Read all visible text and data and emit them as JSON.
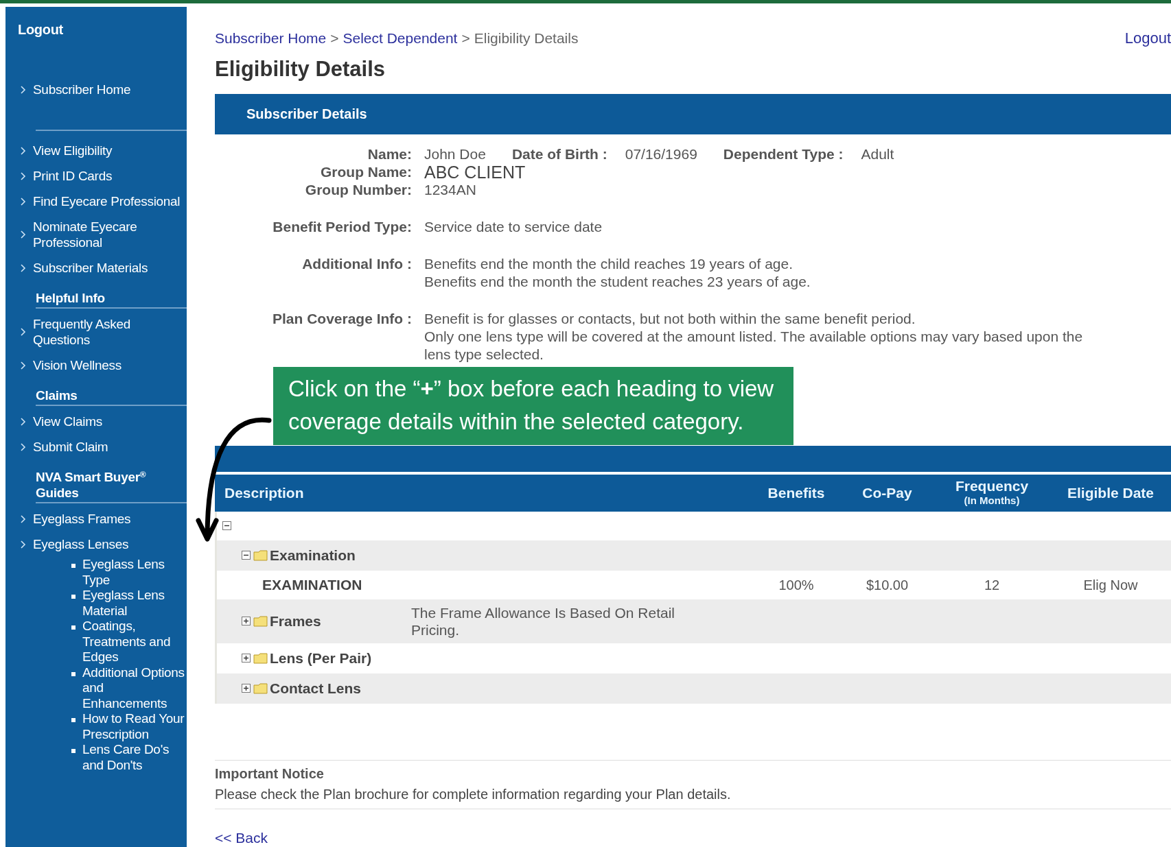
{
  "breadcrumb": {
    "separator": ">",
    "items": [
      {
        "label": "Subscriber Home",
        "kind": "link"
      },
      {
        "label": "Select Dependent",
        "kind": "link"
      },
      {
        "label": "Eligibility Details",
        "kind": "current"
      }
    ]
  },
  "header_logout": "Logout",
  "page_title": "Eligibility Details",
  "sidebar": {
    "logout": "Logout",
    "items": [
      {
        "kind": "link",
        "label": "Subscriber Home"
      },
      {
        "kind": "rule"
      },
      {
        "kind": "link",
        "label": "View Eligibility"
      },
      {
        "kind": "link",
        "label": "Print ID Cards"
      },
      {
        "kind": "link",
        "label": "Find Eyecare Professional"
      },
      {
        "kind": "link",
        "label": "Nominate Eyecare Professional"
      },
      {
        "kind": "link",
        "label": "Subscriber Materials"
      },
      {
        "kind": "heading",
        "label": "Helpful Info"
      },
      {
        "kind": "link",
        "label": "Frequently Asked Questions"
      },
      {
        "kind": "link",
        "label": "Vision Wellness"
      },
      {
        "kind": "heading",
        "label": "Claims"
      },
      {
        "kind": "link",
        "label": "View Claims"
      },
      {
        "kind": "link",
        "label": "Submit Claim"
      },
      {
        "kind": "heading",
        "label": "NVA Smart Buyer$^{®}$ Guides"
      },
      {
        "kind": "link",
        "label": "Eyeglass Frames"
      },
      {
        "kind": "link",
        "label": "Eyeglass Lenses"
      },
      {
        "kind": "bullet",
        "label": "Eyeglass Lens Type"
      },
      {
        "kind": "bullet",
        "label": "Eyeglass Lens Material"
      },
      {
        "kind": "bullet",
        "label": "Coatings, Treatments and Edges"
      },
      {
        "kind": "bullet",
        "label": "Additional Options and Enhancements"
      },
      {
        "kind": "bullet",
        "label": "How to Read Your Prescription"
      },
      {
        "kind": "bullet",
        "label": "Lens Care Do's and Don'ts"
      }
    ]
  },
  "subscriber_details": {
    "title": "Subscriber Details",
    "rows": [
      {
        "kind": "id",
        "label": "Name:",
        "lines": [
          "John Doe"
        ],
        "extras": [
          {
            "label": "Date of Birth :",
            "value": "07/16/1969"
          },
          {
            "label": "Dependent Type :",
            "value": "Adult"
          }
        ]
      },
      {
        "kind": "id-large",
        "label": "Group Name:",
        "lines": [
          "ABC CLIENT"
        ]
      },
      {
        "kind": "id",
        "label": "Group Number:",
        "lines": [
          "1234AN"
        ]
      },
      {
        "kind": "info",
        "label": "Benefit Period Type:",
        "lines": [
          "Service date to service date"
        ]
      },
      {
        "kind": "info",
        "label": "Additional Info :",
        "lines": [
          "Benefits end the month the child reaches 19 years of age.",
          "Benefits end the month the student reaches 23 years of age."
        ]
      },
      {
        "kind": "info",
        "label": "Plan Coverage Info :",
        "lines": [
          "Benefit is for glasses or contacts, but not both within the same benefit period.",
          "Only one lens type will be covered at the amount listed. The available options may vary based upon the",
          "lens type selected."
        ]
      }
    ]
  },
  "callout": {
    "text": "Click on the “**+**” box before each heading to view coverage details within the selected category."
  },
  "table": {
    "columns": [
      {
        "label": "Description"
      },
      {
        "label": "Benefits"
      },
      {
        "label": "Co-Pay"
      },
      {
        "label": "Frequency",
        "sublabel": "(In Months)"
      },
      {
        "label": "Eligible Date"
      }
    ],
    "tree": {
      "expanded": true,
      "children": [
        {
          "label": "Examination",
          "expanded": true,
          "children": [
            {
              "label": "EXAMINATION",
              "benefits": "100%",
              "copay": "$10.00",
              "frequency": "12",
              "eligible_date": "Elig Now"
            }
          ]
        },
        {
          "label": "Frames",
          "expanded": false,
          "note": "The Frame Allowance Is Based On Retail Pricing."
        },
        {
          "label": "Lens (Per Pair)",
          "expanded": false
        },
        {
          "label": "Contact Lens",
          "expanded": false
        }
      ]
    }
  },
  "notice": {
    "title": "Important Notice",
    "text": "Please check the Plan brochure for complete information regarding your Plan details."
  },
  "back_link": "<< Back"
}
